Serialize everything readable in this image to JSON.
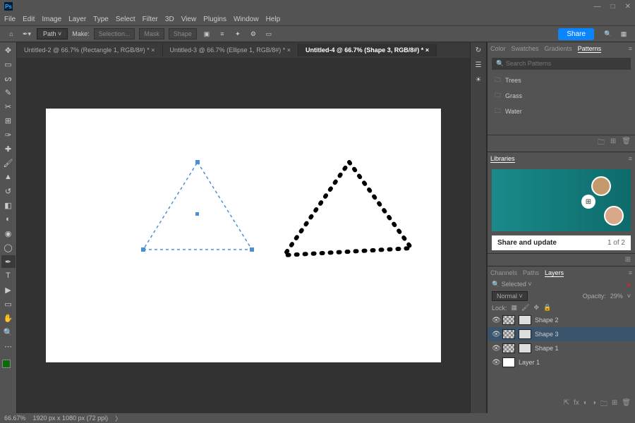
{
  "app": {
    "ps_label": "Ps"
  },
  "window_controls": {
    "min": "—",
    "max": "□",
    "close": "✕"
  },
  "menu": [
    "File",
    "Edit",
    "Image",
    "Layer",
    "Type",
    "Select",
    "Filter",
    "3D",
    "View",
    "Plugins",
    "Window",
    "Help"
  ],
  "options_bar": {
    "mode_label": "Path",
    "make_label": "Make:",
    "selection_btn": "Selection...",
    "mask_btn": "Mask",
    "shape_btn": "Shape",
    "share_label": "Share"
  },
  "document_tabs": [
    "Untitled-2 @ 66.7% (Rectangle 1, RGB/8#) *",
    "Untitled-3 @ 66.7% (Ellipse 1, RGB/8#) *",
    "Untitled-4 @ 66.7% (Shape 3, RGB/8#) *"
  ],
  "active_tab_index": 2,
  "status": {
    "zoom": "66.67%",
    "doc_info": "1920 px x 1080 px (72 ppi)"
  },
  "patterns_panel": {
    "tabs": [
      "Color",
      "Swatches",
      "Gradients",
      "Patterns"
    ],
    "active_tab": "Patterns",
    "search_placeholder": "Search Patterns",
    "folders": [
      "Trees",
      "Grass",
      "Water"
    ]
  },
  "libraries_panel": {
    "title": "Libraries",
    "caption": "Share and update",
    "page": "1 of 2"
  },
  "layers_panel": {
    "tabs": [
      "Channels",
      "Paths",
      "Layers"
    ],
    "active_tab": "Layers",
    "filter_label": "Selected",
    "blend_mode": "Normal",
    "opacity_label": "Opacity:",
    "opacity_value": "29%",
    "lock_label": "Lock:",
    "layers": [
      {
        "name": "Shape 2",
        "selected": false,
        "shape": true
      },
      {
        "name": "Shape 3",
        "selected": true,
        "shape": true
      },
      {
        "name": "Shape 1",
        "selected": false,
        "shape": true
      },
      {
        "name": "Layer 1",
        "selected": false,
        "shape": false
      }
    ]
  }
}
